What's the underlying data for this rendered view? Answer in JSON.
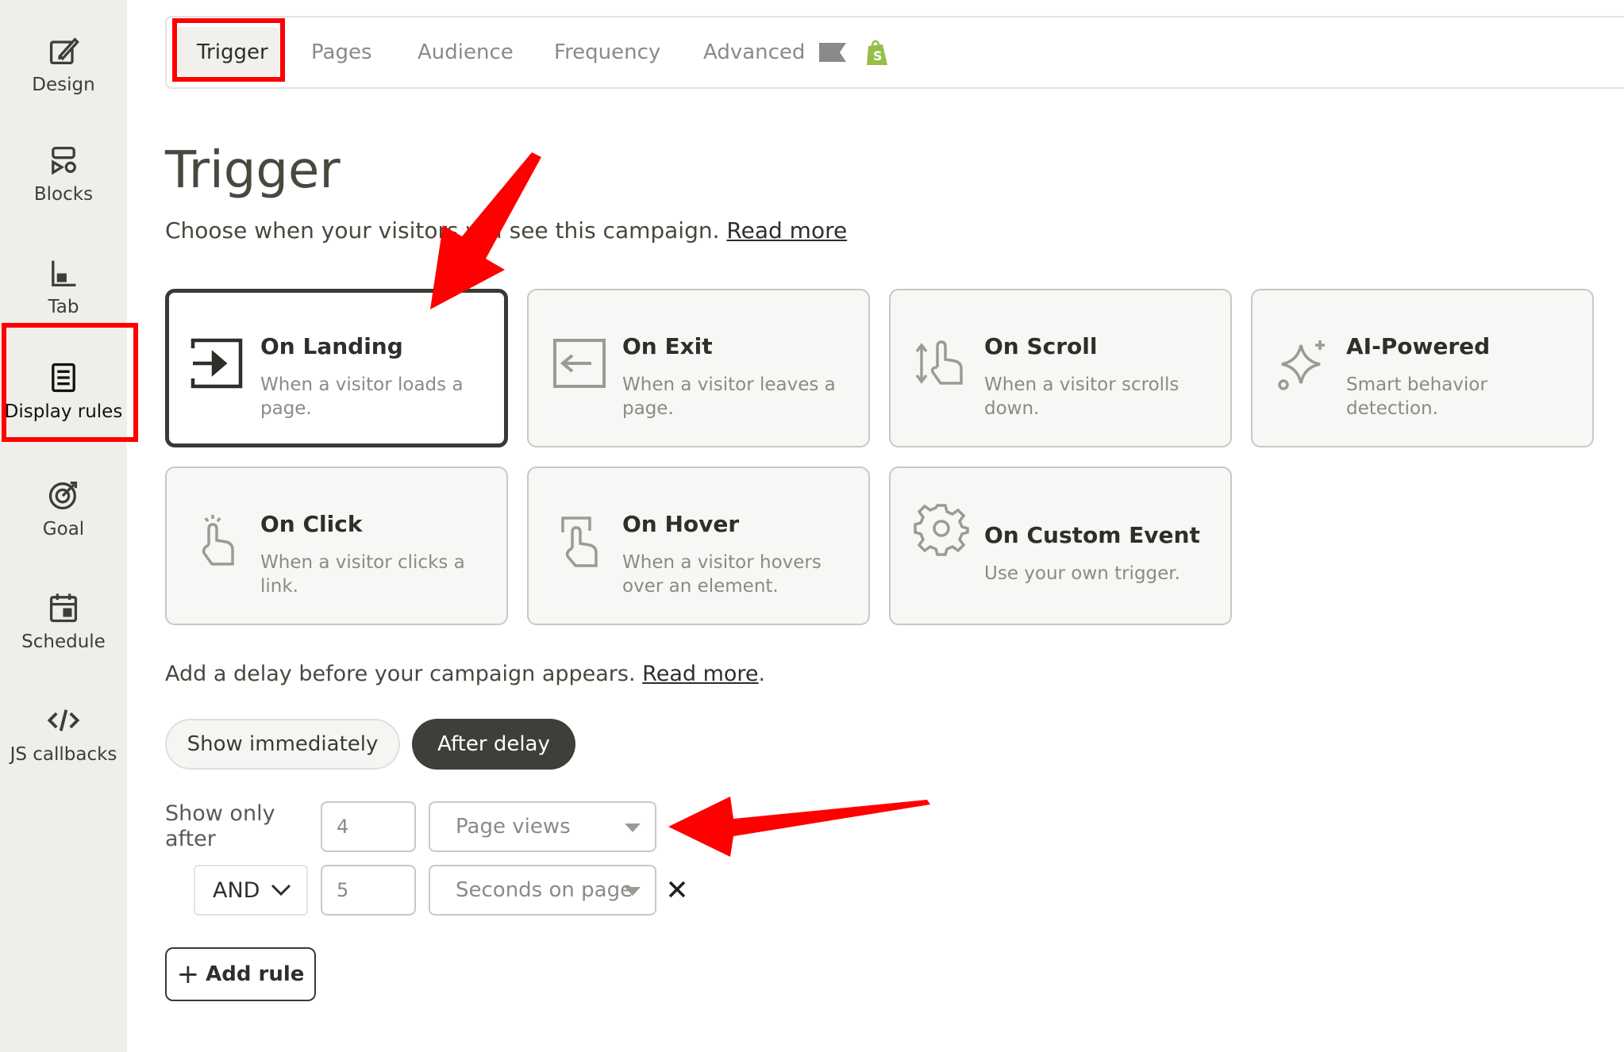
{
  "sidebar": {
    "items": [
      {
        "label": "Design",
        "icon": "design-icon"
      },
      {
        "label": "Blocks",
        "icon": "blocks-icon"
      },
      {
        "label": "Tab",
        "icon": "tab-icon"
      },
      {
        "label": "Display rules",
        "icon": "display-rules-icon"
      },
      {
        "label": "Goal",
        "icon": "goal-icon"
      },
      {
        "label": "Schedule",
        "icon": "calendar-icon"
      },
      {
        "label": "JS callbacks",
        "icon": "code-icon"
      }
    ],
    "active": "Display rules"
  },
  "tabs": {
    "items": [
      {
        "label": "Trigger"
      },
      {
        "label": "Pages"
      },
      {
        "label": "Audience"
      },
      {
        "label": "Frequency"
      },
      {
        "label": "Advanced"
      }
    ],
    "active": "Trigger",
    "advanced_icons": [
      "flag-icon",
      "shopify-icon"
    ]
  },
  "header": {
    "title": "Trigger",
    "subtitle": "Choose when your visitors will see this campaign.",
    "read_more": "Read more"
  },
  "triggers": [
    {
      "title": "On Landing",
      "desc": "When a visitor loads a page.",
      "icon": "enter-icon",
      "selected": true
    },
    {
      "title": "On Exit",
      "desc": "When a visitor leaves a page.",
      "icon": "exit-icon"
    },
    {
      "title": "On Scroll",
      "desc": "When a visitor scrolls down.",
      "icon": "scroll-icon"
    },
    {
      "title": "AI-Powered",
      "desc": "Smart behavior detection.",
      "icon": "sparkle-icon"
    },
    {
      "title": "On Click",
      "desc": "When a visitor clicks a link.",
      "icon": "click-icon"
    },
    {
      "title": "On Hover",
      "desc": "When a visitor hovers over an element.",
      "icon": "hover-icon"
    },
    {
      "title": "On Custom Event",
      "desc": "Use your own trigger.",
      "icon": "gear-icon"
    }
  ],
  "delay": {
    "text": "Add a delay before your campaign appears.",
    "read_more": "Read more",
    "period": ".",
    "options": [
      "Show immediately",
      "After delay"
    ],
    "selected": "After delay"
  },
  "rules": {
    "label": "Show only after",
    "rows": [
      {
        "value": "4",
        "unit": "Page views"
      },
      {
        "connector": "AND",
        "value": "5",
        "unit": "Seconds on page"
      }
    ],
    "add_label": "Add rule"
  },
  "colors": {
    "highlight": "#ff0000",
    "dark": "#3f3f39",
    "sidebar_bg": "#efeeea"
  }
}
